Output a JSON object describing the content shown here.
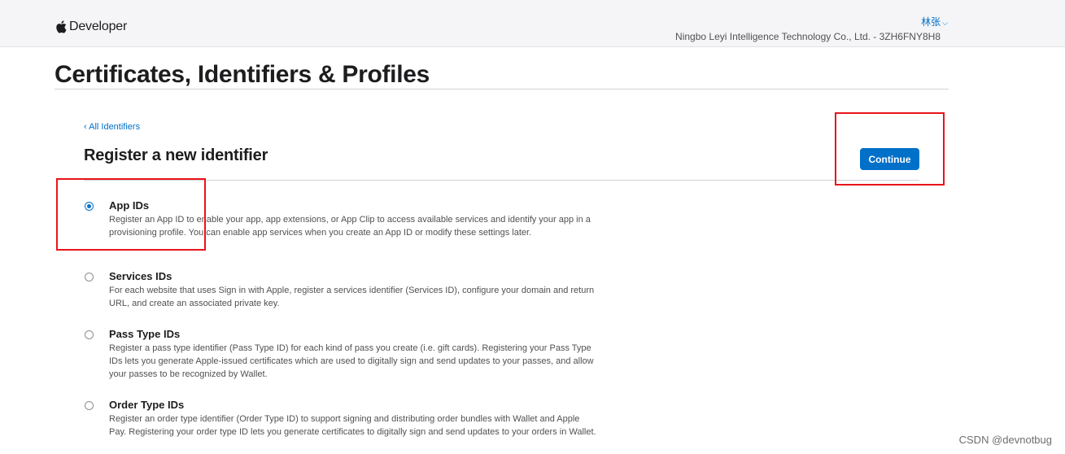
{
  "header": {
    "logo_text": "Developer",
    "user_name": "林张",
    "user_chevron": "⌵",
    "team": "Ningbo Leyi Intelligence Technology Co., Ltd. - 3ZH6FNY8H8"
  },
  "page": {
    "title": "Certificates, Identifiers & Profiles"
  },
  "content": {
    "back_link": "‹ All Identifiers",
    "section_title": "Register a new identifier",
    "continue_label": "Continue"
  },
  "options": [
    {
      "title": "App IDs",
      "description": "Register an App ID to enable your app, app extensions, or App Clip to access available services and identify your app in a provisioning profile. You can enable app services when you create an App ID or modify these settings later.",
      "selected": true
    },
    {
      "title": "Services IDs",
      "description": "For each website that uses Sign in with Apple, register a services identifier (Services ID), configure your domain and return URL, and create an associated private key.",
      "selected": false
    },
    {
      "title": "Pass Type IDs",
      "description": "Register a pass type identifier (Pass Type ID) for each kind of pass you create (i.e. gift cards). Registering your Pass Type IDs lets you generate Apple-issued certificates which are used to digitally sign and send updates to your passes, and allow your passes to be recognized by Wallet.",
      "selected": false
    },
    {
      "title": "Order Type IDs",
      "description": "Register an order type identifier (Order Type ID) to support signing and distributing order bundles with Wallet and Apple Pay. Registering your order type ID lets you generate certificates to digitally sign and send updates to your orders in Wallet.",
      "selected": false
    }
  ],
  "watermark": "CSDN @devnotbug",
  "colors": {
    "accent": "#0070c9",
    "highlight_box": "#e8141a"
  }
}
